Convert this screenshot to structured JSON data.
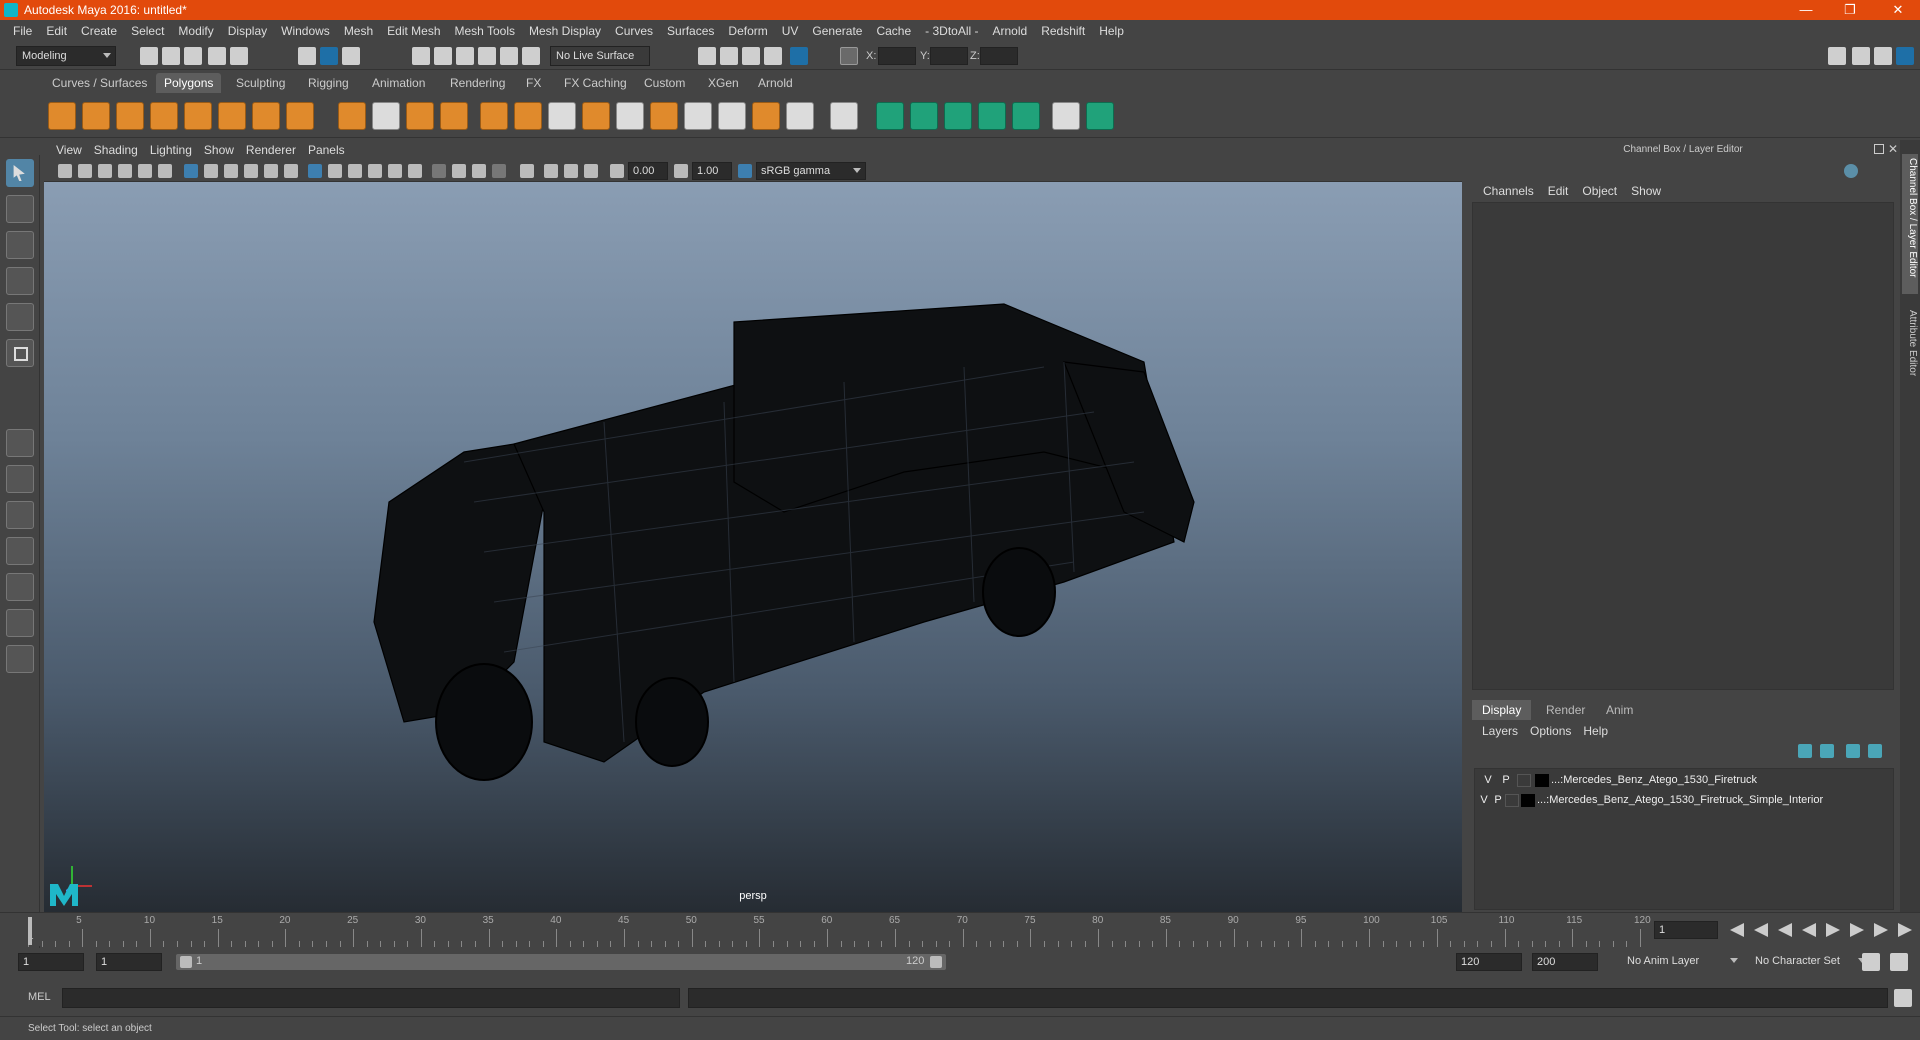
{
  "window": {
    "title": "Autodesk Maya 2016: untitled*"
  },
  "menubar": [
    "File",
    "Edit",
    "Create",
    "Select",
    "Modify",
    "Display",
    "Windows",
    "Mesh",
    "Edit Mesh",
    "Mesh Tools",
    "Mesh Display",
    "Curves",
    "Surfaces",
    "Deform",
    "UV",
    "Generate",
    "Cache",
    "- 3DtoAll -",
    "Arnold",
    "Redshift",
    "Help"
  ],
  "statusline": {
    "mode": "Modeling",
    "live_surface": "No Live Surface",
    "x_label": "X:",
    "y_label": "Y:",
    "z_label": "Z:"
  },
  "shelf_tabs": [
    "Curves / Surfaces",
    "Polygons",
    "Sculpting",
    "Rigging",
    "Animation",
    "Rendering",
    "FX",
    "FX Caching",
    "Custom",
    "XGen",
    "Arnold"
  ],
  "shelf_active": "Polygons",
  "viewport": {
    "menu": [
      "View",
      "Shading",
      "Lighting",
      "Show",
      "Renderer",
      "Panels"
    ],
    "exposure": "0.00",
    "gamma": "1.00",
    "color_space": "sRGB gamma",
    "camera_label": "persp"
  },
  "channel_box": {
    "title": "Channel Box / Layer Editor",
    "menu": [
      "Channels",
      "Edit",
      "Object",
      "Show"
    ]
  },
  "layer_editor": {
    "tabs": [
      "Display",
      "Render",
      "Anim"
    ],
    "active_tab": "Display",
    "menu": [
      "Layers",
      "Options",
      "Help"
    ],
    "layers": [
      {
        "v": "V",
        "p": "P",
        "name": "...:Mercedes_Benz_Atego_1530_Firetruck"
      },
      {
        "v": "V",
        "p": "P",
        "name": "...:Mercedes_Benz_Atego_1530_Firetruck_Simple_Interior"
      }
    ]
  },
  "side_tabs": [
    "Channel Box / Layer Editor",
    "Attribute Editor"
  ],
  "timeslider": {
    "ticks": [
      5,
      10,
      15,
      20,
      25,
      30,
      35,
      40,
      45,
      50,
      55,
      60,
      65,
      70,
      75,
      80,
      85,
      90,
      95,
      100,
      105,
      110,
      115,
      120
    ],
    "start_label": "1",
    "current_frame": "1"
  },
  "range": {
    "start": "1",
    "playback_start": "1",
    "range_start_label": "1",
    "range_end_label": "120",
    "playback_end": "120",
    "end": "200",
    "anim_layer": "No Anim Layer",
    "character_set": "No Character Set"
  },
  "cmdline": {
    "label": "MEL"
  },
  "helpline": {
    "text": "Select Tool: select an object"
  }
}
